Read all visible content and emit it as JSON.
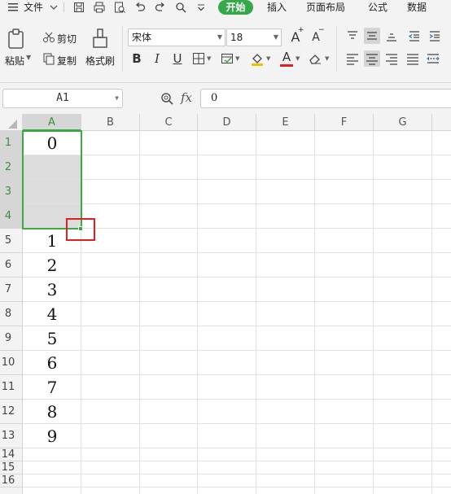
{
  "menu": {
    "file_label": "文件",
    "tabs": [
      "开始",
      "插入",
      "页面布局",
      "公式",
      "数据"
    ]
  },
  "ribbon": {
    "paste_label": "粘贴",
    "cut_label": "剪切",
    "copy_label": "复制",
    "format_painter_label": "格式刷",
    "font_name": "宋体",
    "font_size": "18",
    "bold_glyph": "B",
    "italic_glyph": "I",
    "underline_glyph": "U",
    "font_color_glyph": "A",
    "grow_font_glyph": "A",
    "shrink_font_glyph": "A",
    "accent_colors": {
      "font_color": "#e02020",
      "fill_color": "#f0c000",
      "home_tab": "#35a84a"
    }
  },
  "formula_bar": {
    "name_box": "A1",
    "fx_label": "fx",
    "content": "0"
  },
  "sheet": {
    "columns": [
      "A",
      "B",
      "C",
      "D",
      "E",
      "F",
      "G"
    ],
    "rows": [
      "1",
      "2",
      "3",
      "4",
      "5",
      "6",
      "7",
      "8",
      "9",
      "10",
      "11",
      "12",
      "13",
      "14",
      "15",
      "16"
    ],
    "column_a_values": [
      "0",
      "",
      "",
      "",
      "1",
      "2",
      "3",
      "4",
      "5",
      "6",
      "7",
      "8",
      "9",
      "",
      "",
      ""
    ],
    "selection": "A1:A4",
    "selection_color": "#3ea845",
    "highlight_color": "#e02020"
  }
}
